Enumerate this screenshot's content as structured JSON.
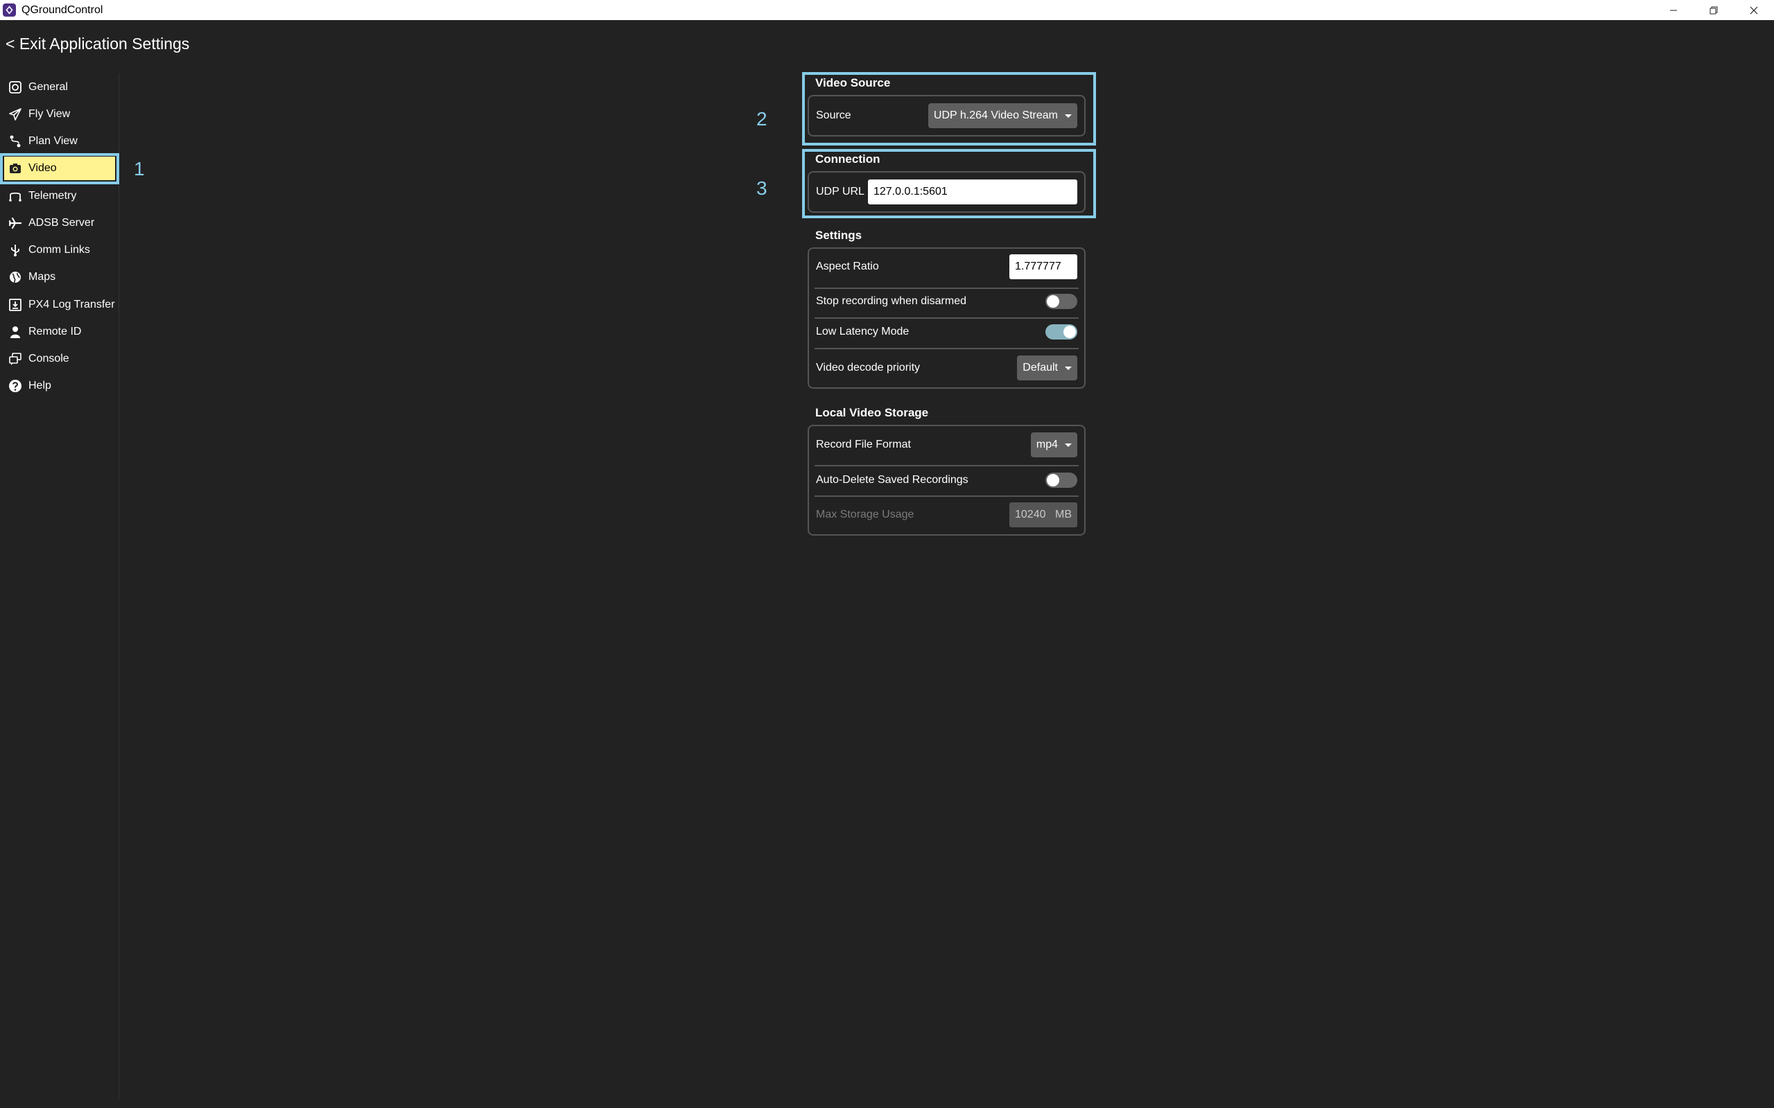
{
  "window": {
    "title": "QGroundControl",
    "controls": [
      "minimize-icon",
      "restore-icon",
      "close-icon"
    ]
  },
  "header": {
    "exit_label": "< Exit Application Settings"
  },
  "sidebar": {
    "items": [
      {
        "label": "General",
        "icon": "qgc-logo-icon"
      },
      {
        "label": "Fly View",
        "icon": "paper-plane-icon"
      },
      {
        "label": "Plan View",
        "icon": "route-icon"
      },
      {
        "label": "Video",
        "icon": "camera-icon",
        "active": true
      },
      {
        "label": "Telemetry",
        "icon": "telemetry-icon"
      },
      {
        "label": "ADSB Server",
        "icon": "airplane-icon"
      },
      {
        "label": "Comm Links",
        "icon": "usb-icon"
      },
      {
        "label": "Maps",
        "icon": "globe-icon"
      },
      {
        "label": "PX4 Log Transfer",
        "icon": "download-icon"
      },
      {
        "label": "Remote ID",
        "icon": "person-icon"
      },
      {
        "label": "Console",
        "icon": "chat-icon"
      },
      {
        "label": "Help",
        "icon": "help-icon"
      }
    ]
  },
  "callouts": [
    "1",
    "2",
    "3"
  ],
  "video_source": {
    "title": "Video Source",
    "source_label": "Source",
    "source_value": "UDP h.264 Video Stream"
  },
  "connection": {
    "title": "Connection",
    "udp_label": "UDP URL",
    "udp_value": "127.0.0.1:5601"
  },
  "settings": {
    "title": "Settings",
    "aspect_label": "Aspect Ratio",
    "aspect_value": "1.777777",
    "stop_recording_label": "Stop recording when disarmed",
    "stop_recording_on": false,
    "low_latency_label": "Low Latency Mode",
    "low_latency_on": true,
    "decode_label": "Video decode priority",
    "decode_value": "Default"
  },
  "storage": {
    "title": "Local Video Storage",
    "format_label": "Record File Format",
    "format_value": "mp4",
    "auto_delete_label": "Auto-Delete Saved Recordings",
    "auto_delete_on": false,
    "max_label": "Max Storage Usage",
    "max_value": "10240",
    "max_unit": "MB"
  },
  "colors": {
    "background": "#222222",
    "highlight": "#87cce8",
    "active_nav": "#fff291",
    "panel_border": "#555555",
    "combo": "#5f5f5f"
  }
}
